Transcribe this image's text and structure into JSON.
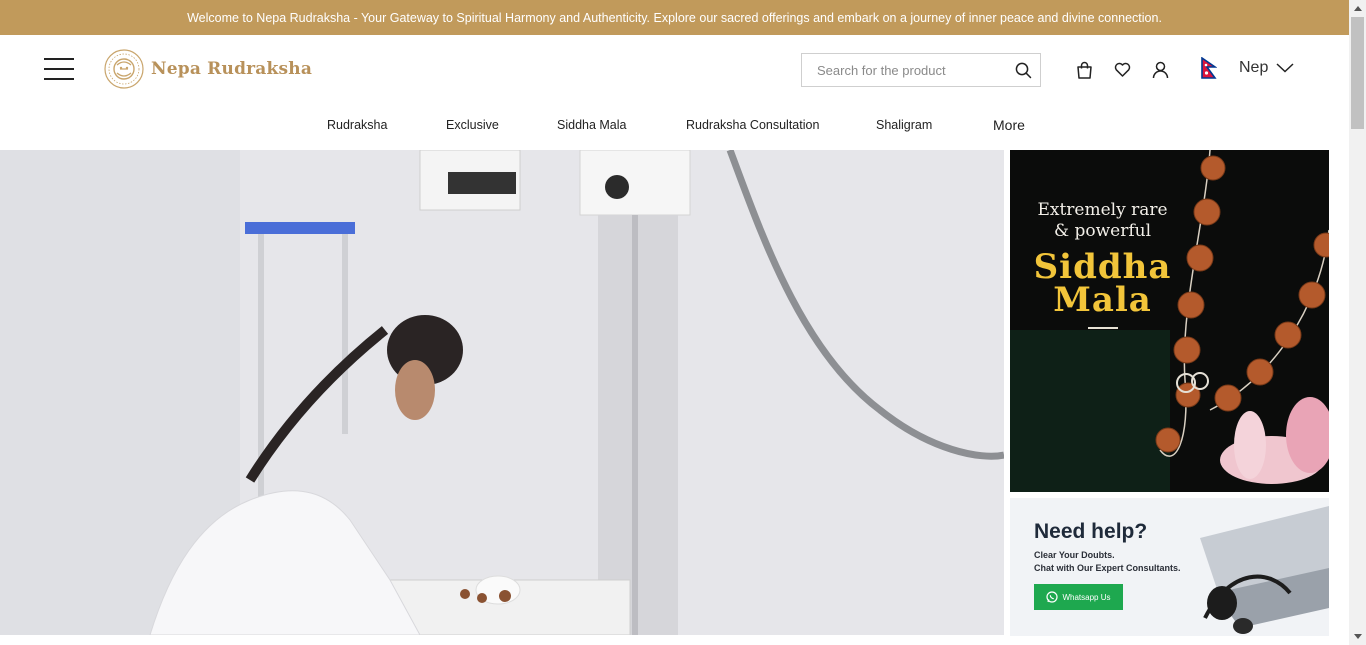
{
  "announcement": {
    "text": "Welcome to Nepa Rudraksha - Your Gateway to Spiritual Harmony and Authenticity. Explore our sacred offerings and embark on a journey of inner peace and divine connection."
  },
  "header": {
    "menu_icon": "hamburger-menu-icon",
    "logo_text": "Nepa Rudraksha",
    "search": {
      "placeholder": "Search for the product",
      "value": ""
    },
    "icons": [
      "shopping-bag-icon",
      "heart-icon",
      "user-icon"
    ],
    "country": {
      "label": "Nep",
      "flag": "nepal-flag-icon"
    }
  },
  "nav": {
    "items": [
      {
        "label": "Rudraksha"
      },
      {
        "label": "Exclusive"
      },
      {
        "label": "Siddha Mala"
      },
      {
        "label": "Rudraksha Consultation"
      },
      {
        "label": "Shaligram"
      },
      {
        "label": "More"
      }
    ]
  },
  "promos": {
    "siddha": {
      "line1": "Extremely rare",
      "line2": "& powerful",
      "title1": "Siddha",
      "title2": "Mala"
    },
    "help": {
      "title": "Need help?",
      "line1": "Clear Your Doubts.",
      "line2": "Chat with Our Expert Consultants.",
      "button": "Whatsapp Us"
    }
  },
  "colors": {
    "accent": "#c19a5b",
    "logo": "#b8915a",
    "siddha_gold": "#f2c53a",
    "whatsapp_green": "#1ea84f"
  }
}
